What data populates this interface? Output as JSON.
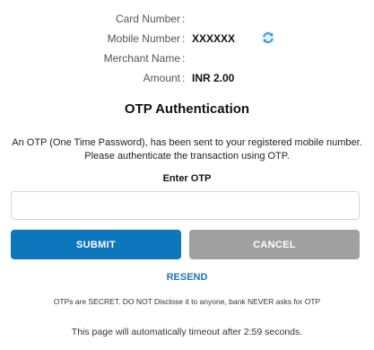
{
  "details": {
    "card_number": {
      "label": "Card Number",
      "value": ""
    },
    "mobile_number": {
      "label": "Mobile Number",
      "value": "XXXXXX"
    },
    "merchant_name": {
      "label": "Merchant Name",
      "value": ""
    },
    "amount": {
      "label": "Amount",
      "value": "INR 2.00"
    },
    "colon": ":"
  },
  "title": "OTP Authentication",
  "message": "An OTP (One Time Password), has been sent to your registered mobile number. Please authenticate the transaction using OTP.",
  "otp": {
    "label": "Enter OTP",
    "value": "",
    "placeholder": ""
  },
  "buttons": {
    "submit": "SUBMIT",
    "cancel": "CANCEL",
    "resend": "RESEND"
  },
  "note": "OTPs are SECRET. DO NOT Disclose it to anyone, bank NEVER asks for OTP",
  "timeout": "This page will automatically timeout after 2:59 seconds.",
  "icons": {
    "refresh": "refresh-icon"
  },
  "colors": {
    "primary": "#0e76bc",
    "cancel": "#a0a0a0",
    "link": "#1b75bb",
    "refresh": "#3a9ad9"
  }
}
